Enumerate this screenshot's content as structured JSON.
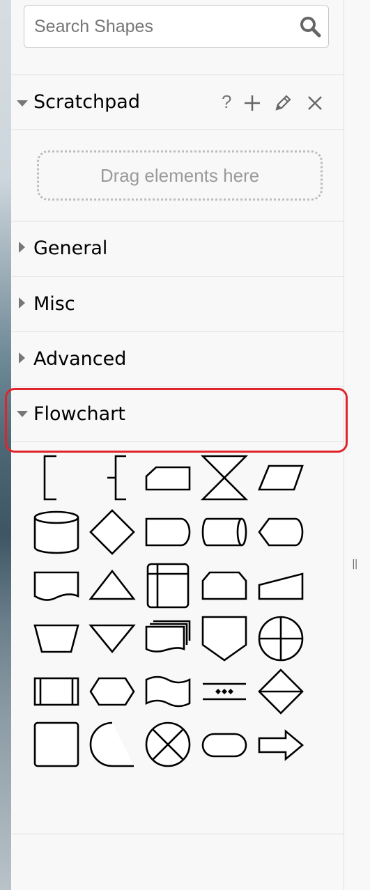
{
  "search": {
    "placeholder": "Search Shapes",
    "icon": "search-icon"
  },
  "scratchpad": {
    "title": "Scratchpad",
    "tools": [
      "help-icon",
      "add-icon",
      "edit-icon",
      "close-icon"
    ],
    "help_label": "?",
    "drop_hint": "Drag elements here"
  },
  "sections": {
    "general": "General",
    "misc": "Misc",
    "advanced": "Advanced",
    "flowchart": "Flowchart"
  },
  "flowchart_shapes": [
    "annotation-1",
    "annotation-2",
    "card",
    "collate",
    "data",
    "database",
    "decision",
    "delay",
    "direct-data",
    "display",
    "document",
    "extract",
    "internal-storage",
    "loop-limit",
    "manual-input",
    "manual-operation",
    "merge",
    "multi-document",
    "off-page-reference",
    "or",
    "predefined-process",
    "preparation",
    "punched-tape",
    "sequential-data",
    "sort",
    "process",
    "stored-data",
    "summing-function",
    "terminator",
    "transfer"
  ],
  "colors": {
    "highlight": "#e0242b",
    "panel_bg": "#f8f8f8",
    "separator": "#dedede"
  }
}
